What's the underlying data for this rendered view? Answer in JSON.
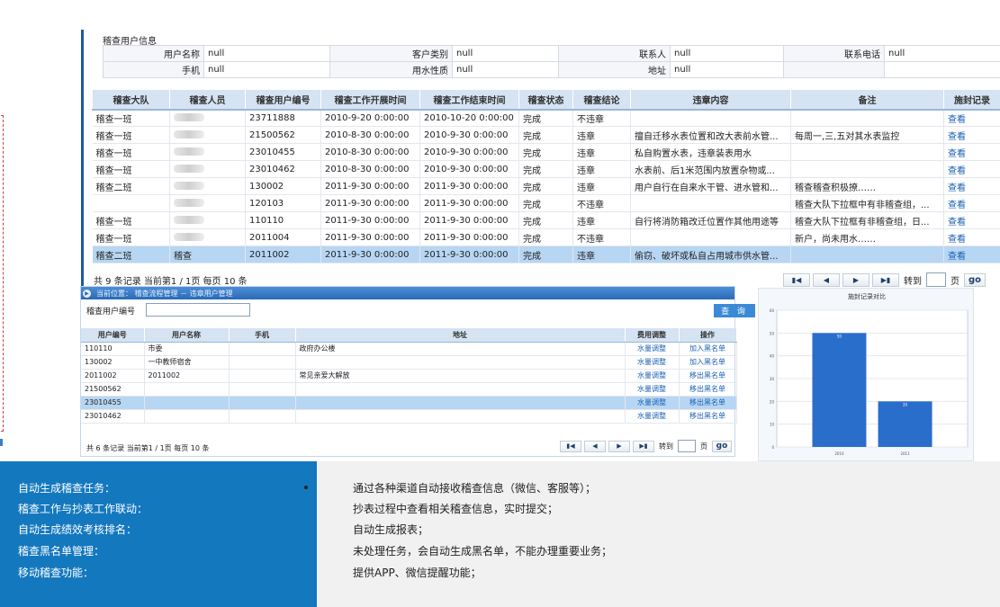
{
  "info": {
    "title": "稽查用户信息",
    "rows": [
      [
        {
          "label": "用户名称",
          "value": "null"
        },
        {
          "label": "客户类别",
          "value": "null"
        },
        {
          "label": "联系人",
          "value": "null"
        },
        {
          "label": "联系电话",
          "value": "null"
        }
      ],
      [
        {
          "label": "手机",
          "value": "null"
        },
        {
          "label": "用水性质",
          "value": "null"
        },
        {
          "label": "地址",
          "value": "null"
        }
      ]
    ]
  },
  "main_table": {
    "headers": [
      "稽查大队",
      "稽查人员",
      "稽查用户编号",
      "稽查工作开展时间",
      "稽查工作结束时间",
      "稽查状态",
      "稽查结论",
      "违章内容",
      "备注",
      "施封记录"
    ],
    "rows": [
      {
        "team": "稽查一班",
        "person": "",
        "user_no": "23711888",
        "start": "2010-9-20 0:00:00",
        "end": "2010-10-20 0:00:00",
        "status": "完成",
        "conclusion": "不违章",
        "content": "",
        "remark": "",
        "record": "查看",
        "selected": false
      },
      {
        "team": "稽查一班",
        "person": "",
        "user_no": "21500562",
        "start": "2010-8-30 0:00:00",
        "end": "2010-9-30 0:00:00",
        "status": "完成",
        "conclusion": "违章",
        "content": "擅自迁移水表位置和改大表前水管...",
        "remark": "每周一,三,五对其水表监控",
        "record": "查看",
        "selected": false
      },
      {
        "team": "稽查一班",
        "person": "",
        "user_no": "23010455",
        "start": "2010-8-30 0:00:00",
        "end": "2010-9-30 0:00:00",
        "status": "完成",
        "conclusion": "违章",
        "content": "私自购置水表，违章装表用水",
        "remark": "",
        "record": "查看",
        "selected": false
      },
      {
        "team": "稽查一班",
        "person": "",
        "user_no": "23010462",
        "start": "2010-8-30 0:00:00",
        "end": "2010-9-30 0:00:00",
        "status": "完成",
        "conclusion": "违章",
        "content": "水表前、后1米范围内放置杂物或...",
        "remark": "",
        "record": "查看",
        "selected": false
      },
      {
        "team": "稽查二班",
        "person": "",
        "user_no": "130002",
        "start": "2011-9-30 0:00:00",
        "end": "2011-9-30 0:00:00",
        "status": "完成",
        "conclusion": "违章",
        "content": "用户自行在自来水干管、进水管和...",
        "remark": "稽查稽查积极撩……",
        "record": "查看",
        "selected": false
      },
      {
        "team": "",
        "person": "",
        "user_no": "120103",
        "start": "2011-9-30 0:00:00",
        "end": "2011-9-30 0:00:00",
        "status": "完成",
        "conclusion": "不违章",
        "content": "",
        "remark": "稽查大队下拉框中有非稽查组，...",
        "record": "查看",
        "selected": false
      },
      {
        "team": "稽查一班",
        "person": "",
        "user_no": "110110",
        "start": "2011-9-30 0:00:00",
        "end": "2011-9-30 0:00:00",
        "status": "完成",
        "conclusion": "违章",
        "content": "自行将消防箱改迁位置作其他用途等",
        "remark": "稽查大队下拉框有非稽查组，日...",
        "record": "查看",
        "selected": false
      },
      {
        "team": "稽查一班",
        "person": "",
        "user_no": "2011004",
        "start": "2011-9-30 0:00:00",
        "end": "2011-9-30 0:00:00",
        "status": "完成",
        "conclusion": "不违章",
        "content": "",
        "remark": "新户，尚未用水……",
        "record": "查看",
        "selected": false
      },
      {
        "team": "稽查二班",
        "person": "稽查",
        "user_no": "2011002",
        "start": "2011-9-30 0:00:00",
        "end": "2011-9-30 0:00:00",
        "status": "完成",
        "conclusion": "违章",
        "content": "偷窃、破坏或私自占用城市供水管...",
        "remark": "",
        "record": "查看",
        "selected": true
      }
    ],
    "footer": "共 9 条记录 当前第1 / 1页 每页 10 条",
    "pager": {
      "goto_label": "转到",
      "page_label": "页",
      "go_label": "go"
    }
  },
  "blacklist": {
    "location": "当前位置： 稽查流程管理 － 违章用户管理",
    "search_label": "稽查用户编号",
    "search_value": "",
    "query_button": "查 询",
    "headers": [
      "用户编号",
      "用户名称",
      "手机",
      "地址",
      "费用调整",
      "操作"
    ],
    "rows": [
      {
        "no": "110110",
        "name": "市委",
        "phone": "",
        "address": "政府办公楼",
        "fee": "水量调整",
        "op": "加入黑名单",
        "selected": false
      },
      {
        "no": "130002",
        "name": "一中教师宿舍",
        "phone": "",
        "address": "",
        "fee": "水量调整",
        "op": "加入黑名单",
        "selected": false
      },
      {
        "no": "2011002",
        "name": "2011002",
        "phone": "",
        "address": "常见亲爱大解放",
        "fee": "水量调整",
        "op": "移出黑名单",
        "selected": false
      },
      {
        "no": "21500562",
        "name": "",
        "phone": "",
        "address": "",
        "fee": "水量调整",
        "op": "移出黑名单",
        "selected": false
      },
      {
        "no": "23010455",
        "name": "",
        "phone": "",
        "address": "",
        "fee": "水量调整",
        "op": "移出黑名单",
        "selected": true
      },
      {
        "no": "23010462",
        "name": "",
        "phone": "",
        "address": "",
        "fee": "水量调整",
        "op": "移出黑名单",
        "selected": false
      }
    ],
    "footer": "共 6 条记录 当前第1 / 1页 每页 10 条",
    "pager": {
      "goto_label": "转到",
      "page_label": "页",
      "go_label": "go"
    }
  },
  "chart_data": {
    "type": "bar",
    "title": "施封记录对比",
    "categories": [
      "2010",
      "2011"
    ],
    "values": [
      50,
      20
    ],
    "data_labels": [
      "50",
      "20"
    ],
    "ylim": [
      0,
      60
    ],
    "yticks": [
      "0",
      "10",
      "20",
      "30",
      "40",
      "50",
      "60"
    ],
    "grid": true,
    "bar_color": "#2a6ecc"
  },
  "features": [
    "自动生成稽查任务：",
    "稽查工作与抄表工作联动：",
    "自动生成绩效考核排名：",
    "稽查黑名单管理：",
    "移动稽查功能："
  ],
  "descriptions": [
    "通过各种渠道自动接收稽查信息（微信、客服等）；",
    "抄表过程中查看相关稽查信息，实时提交；",
    "自动生成报表；",
    "未处理任务，会自动生成黑名单，不能办理重要业务；",
    "提供APP、微信提醒功能；"
  ],
  "colors": {
    "accent": "#1478bf",
    "header_bg": "#d5e3f3",
    "selected_row": "#b7d6f3",
    "link": "#1a5fb4"
  }
}
